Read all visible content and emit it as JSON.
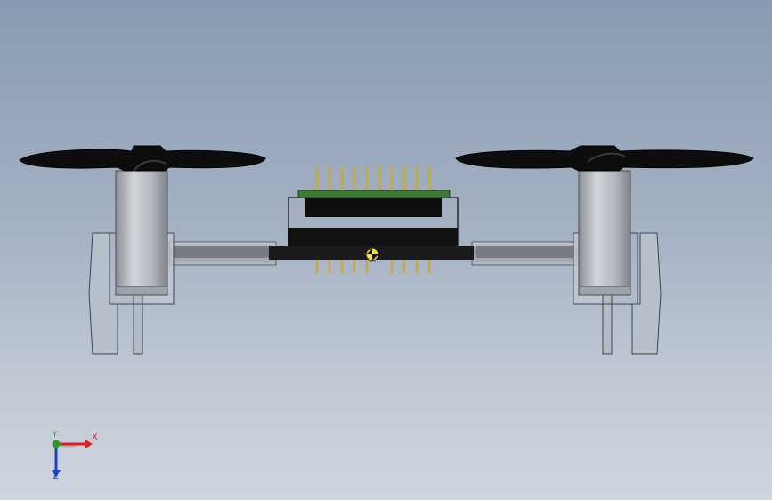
{
  "viewport": {
    "background_top": "#8a9bb1",
    "background_bottom": "#cfd5de"
  },
  "model": {
    "body_color": "#222222",
    "pcb_color": "#3d7a35",
    "pin_color": "#c8a93c",
    "motor_color": "#b8bcc2",
    "propeller_color": "#0c0c0c",
    "frame_color": "#aab4c0"
  },
  "triad": {
    "x_label": "X",
    "y_label": "Y",
    "z_label": "Z",
    "x_color": "#e02020",
    "y_color": "#2a9a2a",
    "z_color": "#2040c0"
  }
}
